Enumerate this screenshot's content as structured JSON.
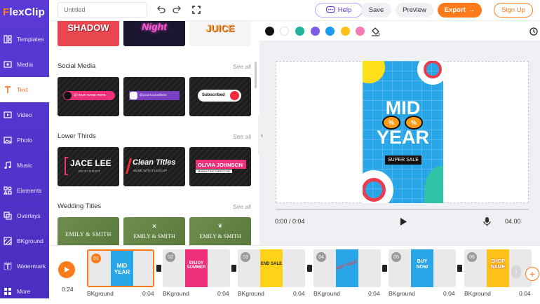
{
  "app": {
    "logo_prefix": "F",
    "logo_rest": "lexClip"
  },
  "sidebar": {
    "items": [
      {
        "label": "Templates",
        "icon": "templates-icon"
      },
      {
        "label": "Media",
        "icon": "media-icon"
      },
      {
        "label": "Text",
        "icon": "text-icon",
        "active": true
      },
      {
        "label": "Video",
        "icon": "video-icon"
      },
      {
        "label": "Photo",
        "icon": "photo-icon"
      },
      {
        "label": "Music",
        "icon": "music-icon"
      },
      {
        "label": "Elements",
        "icon": "elements-icon"
      },
      {
        "label": "Overlays",
        "icon": "overlays-icon"
      },
      {
        "label": "BKground",
        "icon": "background-icon"
      },
      {
        "label": "Watermark",
        "icon": "watermark-icon"
      },
      {
        "label": "More",
        "icon": "more-icon"
      }
    ]
  },
  "toolbar": {
    "title_placeholder": "Untitled",
    "help_label": "Help",
    "save_label": "Save",
    "preview_label": "Preview",
    "export_label": "Export",
    "signup_label": "Sign Up"
  },
  "panel": {
    "top_row": [
      "SHADOW",
      "Night",
      "JUICE"
    ],
    "sections": [
      {
        "title": "Social Media",
        "see_all": "See all",
        "items": [
          "@YOUR NAME HERE",
          "@yourAccounthere",
          "Subscribed"
        ]
      },
      {
        "title": "Lower Thirds",
        "see_all": "See all",
        "items": [
          {
            "main": "JACE LEE",
            "sub": "DESIGNER"
          },
          {
            "main": "Clean Titles",
            "sub": "MADE WITH FLEXCLIP"
          },
          {
            "main": "OLIVIA JOHNSON",
            "sub": "MARKETING DIRECTOR"
          }
        ]
      },
      {
        "title": "Wedding Titles",
        "see_all": "See all",
        "items": [
          {
            "main": "EMILY & SMITH"
          },
          {
            "main": "EMILY & SMITH"
          },
          {
            "main": "EMILY & SMITH"
          }
        ]
      }
    ]
  },
  "colors": [
    "#111111",
    "#ffffff",
    "#1fb59a",
    "#7b5ce6",
    "#1e9bf0",
    "#ffbf1a",
    "#f57bb4"
  ],
  "canvas": {
    "line1": "MID",
    "line2": "YEAR",
    "badge": "SUPER SALE",
    "sunglasses": [
      "%",
      "%"
    ]
  },
  "player": {
    "current": "0:00 / 0:04",
    "total": "04.00"
  },
  "timeline": {
    "total_time": "0:24",
    "clips": [
      {
        "num": "01",
        "label": "BKground",
        "duration": "0:04",
        "text": "MID YEAR",
        "bg": "#29a6e8"
      },
      {
        "num": "02",
        "label": "BKground",
        "duration": "0:04",
        "text": "ENJOY SUMMER",
        "bg": "#ee2f7a"
      },
      {
        "num": "03",
        "label": "BKground",
        "duration": "0:04",
        "text": "END SALE",
        "bg": "#ffd21a"
      },
      {
        "num": "04",
        "label": "BKground",
        "duration": "0:04",
        "text": "HOT SALE",
        "bg": "#29a6e8"
      },
      {
        "num": "05",
        "label": "BKground",
        "duration": "0:04",
        "text": "BUY NOW",
        "bg": "#29a6e8"
      },
      {
        "num": "06",
        "label": "BKground",
        "duration": "0:04",
        "text": "SHOP NAME",
        "bg": "#ffc21a"
      }
    ]
  }
}
